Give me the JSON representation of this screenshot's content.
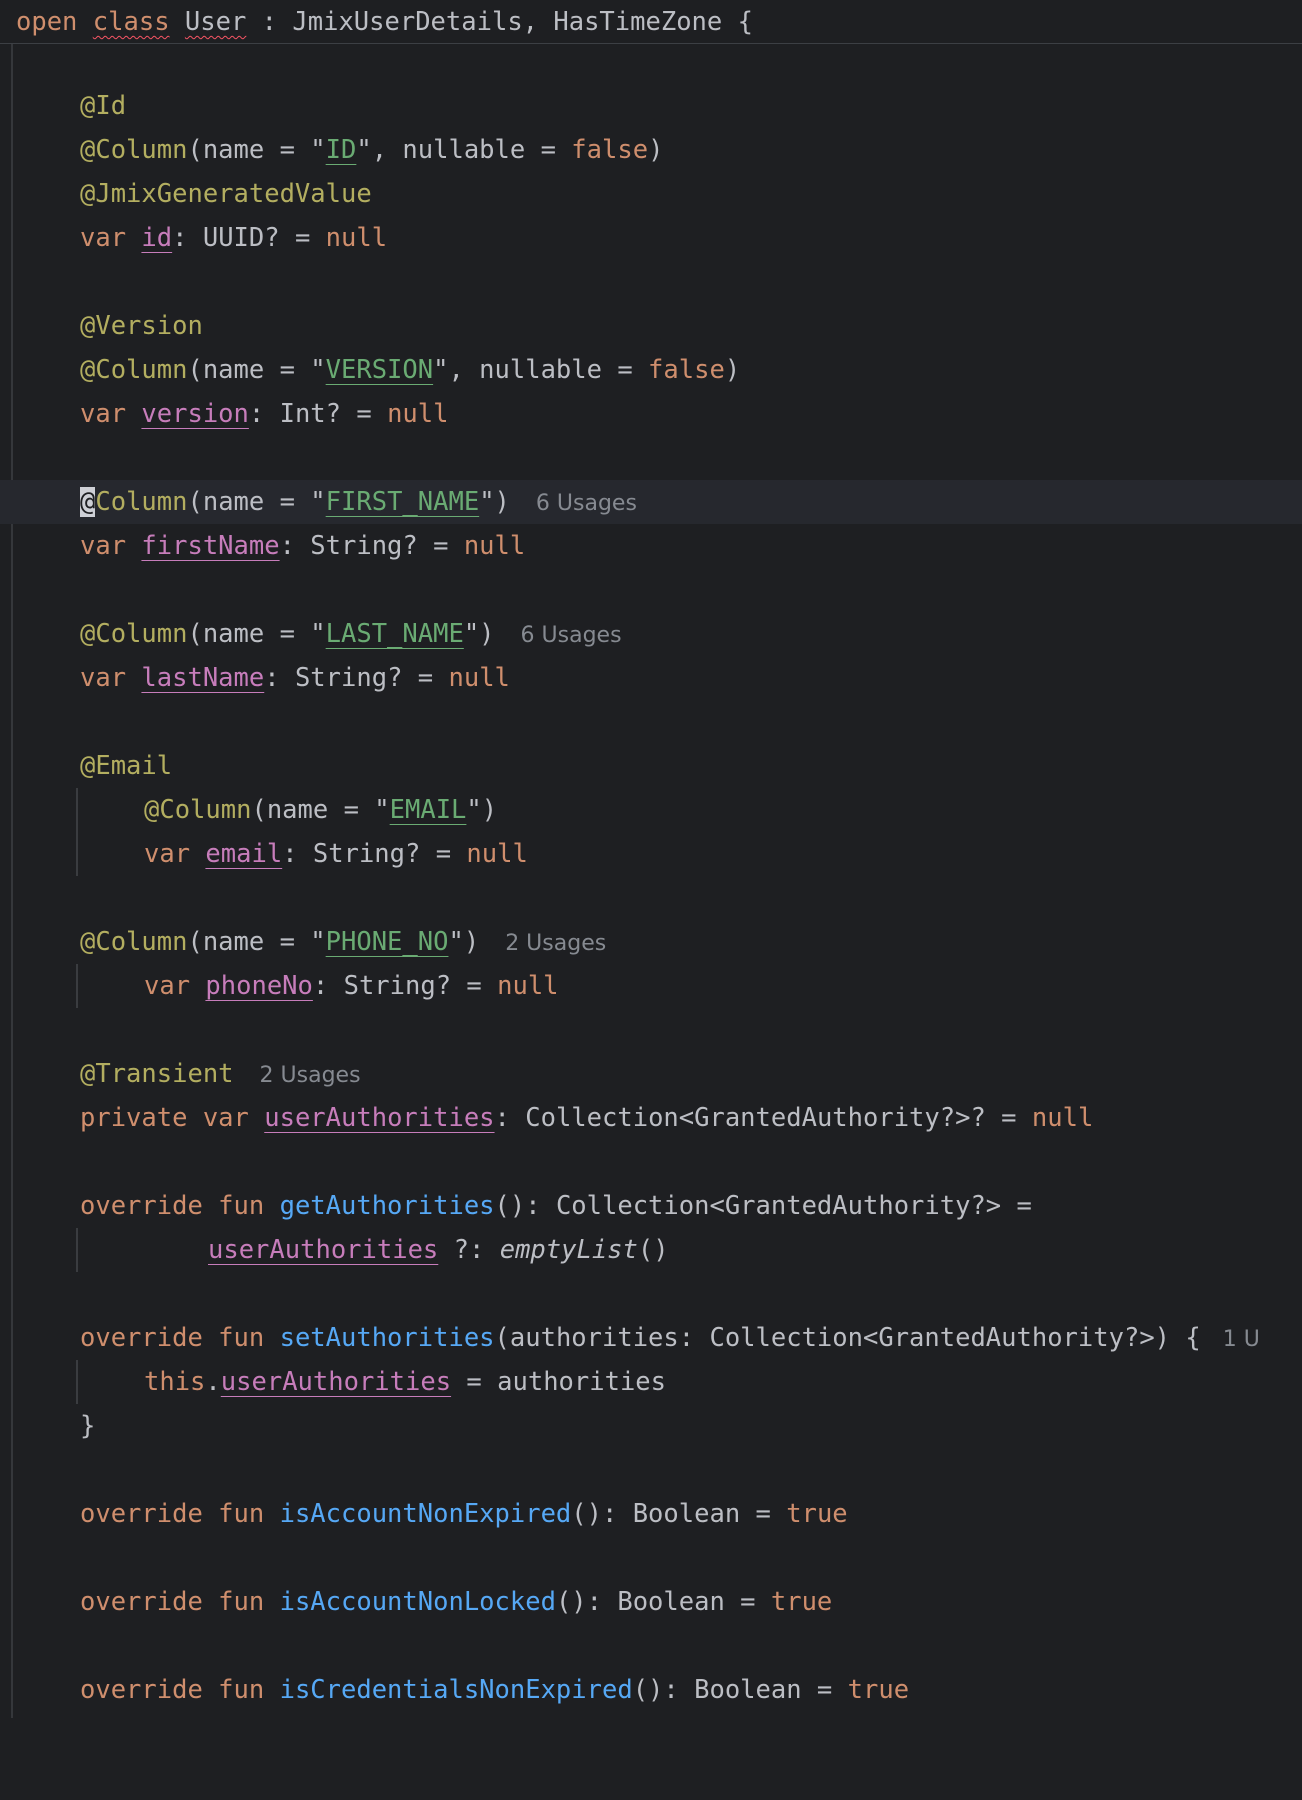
{
  "editor": {
    "header": {
      "kw_open": "open",
      "kw_class": "class",
      "class_name": "User",
      "supertypes": " : JmixUserDetails, HasTimeZone {"
    },
    "lines": {
      "l1_ann": "@Id",
      "l2_ann": "@Column",
      "l2_a": "(name = \"",
      "l2_str": "ID",
      "l2_b": "\", nullable = ",
      "l2_false": "false",
      "l2_c": ")",
      "l3_ann": "@JmixGeneratedValue",
      "l4_var": "var",
      "l4_prop": "id",
      "l4_type": ": UUID? = ",
      "l4_null": "null",
      "l6_ann": "@Version",
      "l7_ann": "@Column",
      "l7_a": "(name = \"",
      "l7_str": "VERSION",
      "l7_b": "\", nullable = ",
      "l7_false": "false",
      "l7_c": ")",
      "l8_var": "var",
      "l8_prop": "version",
      "l8_type": ": Int? = ",
      "l8_null": "null",
      "l10_caret": "@",
      "l10_ann": "Column",
      "l10_a": "(name = \"",
      "l10_str": "FIRST_NAME",
      "l10_c": "\")",
      "l10_hint": "6 Usages",
      "l11_var": "var",
      "l11_prop": "firstName",
      "l11_type": ": String? = ",
      "l11_null": "null",
      "l13_ann": "@Column",
      "l13_a": "(name = \"",
      "l13_str": "LAST_NAME",
      "l13_c": "\")",
      "l13_hint": "6 Usages",
      "l14_var": "var",
      "l14_prop": "lastName",
      "l14_type": ": String? = ",
      "l14_null": "null",
      "l16_ann": "@Email",
      "l17_ann": "@Column",
      "l17_a": "(name = \"",
      "l17_str": "EMAIL",
      "l17_c": "\")",
      "l18_var": "var",
      "l18_prop": "email",
      "l18_type": ": String? = ",
      "l18_null": "null",
      "l20_ann": "@Column",
      "l20_a": "(name = \"",
      "l20_str": "PHONE_NO",
      "l20_c": "\")",
      "l20_hint": "2 Usages",
      "l21_var": "var",
      "l21_prop": "phoneNo",
      "l21_type": ": String? = ",
      "l21_null": "null",
      "l23_ann": "@Transient",
      "l23_hint": "2 Usages",
      "l24_kw": "private var",
      "l24_prop": "userAuthorities",
      "l24_type": ": Collection<GrantedAuthority?>? = ",
      "l24_null": "null",
      "l26_kw": "override fun",
      "l26_fn": "getAuthorities",
      "l26_rest": "(): Collection<GrantedAuthority?> =",
      "l27_prop": "userAuthorities",
      "l27_op": " ?: ",
      "l27_it": "emptyList",
      "l27_c": "()",
      "l29_kw": "override fun",
      "l29_fn": "setAuthorities",
      "l29_rest": "(authorities: Collection<GrantedAuthority?>) {",
      "l29_hint": "1 U",
      "l30_this": "this",
      "l30_dot": ".",
      "l30_prop": "userAuthorities",
      "l30_rest": " = authorities",
      "l31_brace": "}",
      "l33_kw": "override fun",
      "l33_fn": "isAccountNonExpired",
      "l33_rest": "(): Boolean = ",
      "l33_true": "true",
      "l35_kw": "override fun",
      "l35_fn": "isAccountNonLocked",
      "l35_rest": "(): Boolean = ",
      "l35_true": "true",
      "l37_kw": "override fun",
      "l37_fn": "isCredentialsNonExpired",
      "l37_rest": "(): Boolean = ",
      "l37_true": "true"
    }
  }
}
